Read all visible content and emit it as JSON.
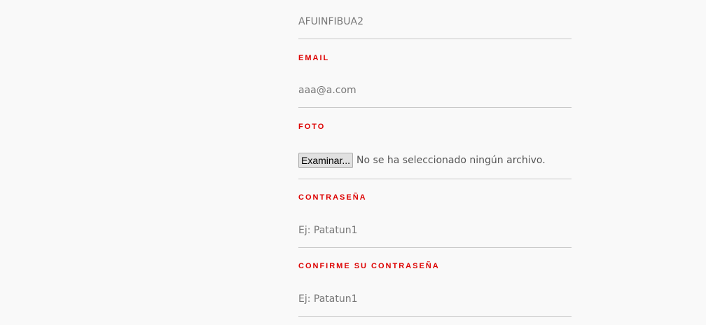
{
  "form": {
    "username": {
      "value": "AFUINFIBUA2"
    },
    "email": {
      "label": "EMAIL",
      "value": "aaa@a.com"
    },
    "photo": {
      "label": "FOTO",
      "button_label": "Examinar...",
      "status": "No se ha seleccionado ningún archivo."
    },
    "password": {
      "label": "CONTRASEÑA",
      "placeholder": "Ej: Patatun1"
    },
    "confirm_password": {
      "label": "CONFIRME SU CONTRASEÑA",
      "placeholder": "Ej: Patatun1"
    }
  },
  "colors": {
    "label": "#dd0000",
    "rule": "#c9c9c9",
    "text": "#777777",
    "background": "#f9f9f9"
  }
}
